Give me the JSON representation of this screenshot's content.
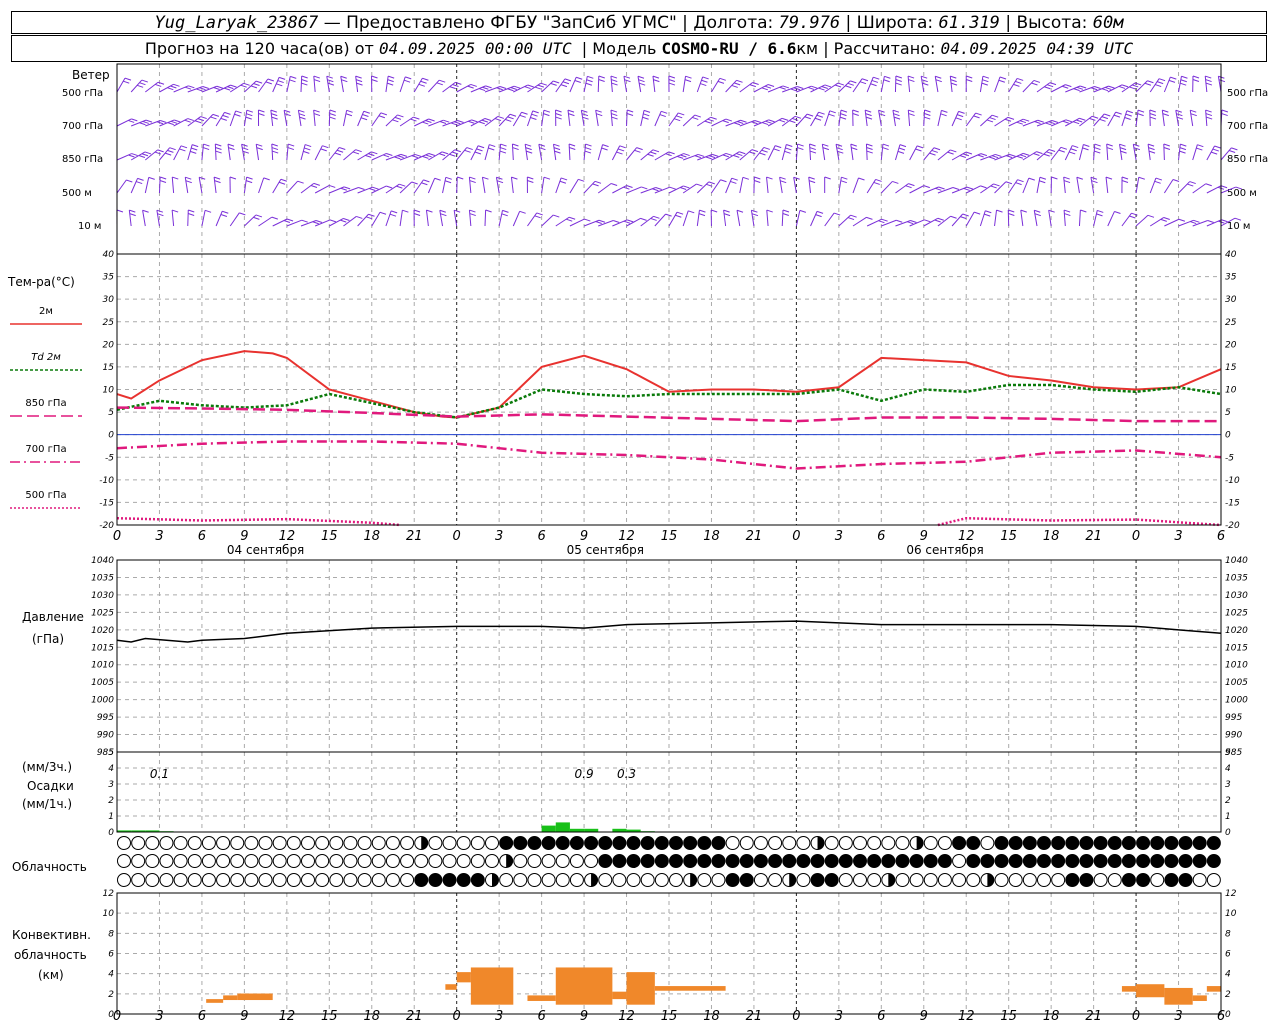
{
  "header": {
    "station": "Yug_Laryak_23867",
    "provider": "— Предоставлено ФГБУ \"ЗапСиб УГМС\" | Долгота:",
    "lon": "79.976",
    "lat_label": "| Широта:",
    "lat": "61.319",
    "alt_label": "| Высота:",
    "alt": "60м",
    "forecast_label": "Прогноз на 120 часа(ов) от",
    "forecast_from": "04.09.2025 00:00 UTC",
    "model_label": "| Модель",
    "model": "COSMO-RU / 6.6",
    "model_unit": "км",
    "calc_label": "| Рассчитано:",
    "calc": "04.09.2025 04:39 UTC"
  },
  "wind_panel": {
    "title": "Ветер",
    "levels": [
      "500 гПа",
      "700 гПа",
      "850 гПа",
      "500 м",
      "10 м"
    ]
  },
  "temp_panel": {
    "title": "Тем-ра(°C)",
    "legend": [
      {
        "label": "2м",
        "color": "#e8322f",
        "dash": ""
      },
      {
        "label": "Td 2м",
        "color": "#0a7a0a",
        "dash": "3,2"
      },
      {
        "label": "850 гПа",
        "color": "#e0197d",
        "dash": "12,5"
      },
      {
        "label": "700 гПа",
        "color": "#e0197d",
        "dash": "10,4,2,4"
      },
      {
        "label": "500 гПа",
        "color": "#e0197d",
        "dash": "2,2"
      }
    ]
  },
  "pressure_panel": {
    "title": "Давление",
    "unit": "(гПа)"
  },
  "precip_panel": {
    "unit3": "(мм/3ч.)",
    "title": "Осадки",
    "unit1": "(мм/1ч.)",
    "labels": [
      {
        "t": 3,
        "text": "0.1"
      },
      {
        "t": 33,
        "text": "0.9"
      },
      {
        "t": 36,
        "text": "0.3"
      }
    ]
  },
  "cloud_panel": {
    "title": "Облачность"
  },
  "conv_panel": {
    "title1": "Конвективн.",
    "title2": "облачность",
    "unit": "(км)"
  },
  "x_hour_labels": [
    "0",
    "3",
    "6",
    "9",
    "12",
    "15",
    "18",
    "21",
    "0",
    "3",
    "6",
    "9",
    "12",
    "15",
    "18",
    "21",
    "0",
    "3",
    "6",
    "9",
    "12",
    "15",
    "18",
    "21",
    "0",
    "3",
    "6"
  ],
  "day_labels": [
    "04 сентября",
    "05 сентября",
    "06 сентября"
  ],
  "colors": {
    "wind": "#7a2fd8",
    "temp2m": "#e8322f",
    "td": "#0a7a0a",
    "upper": "#e0197d",
    "pressure": "#000000",
    "precip": "#18c018",
    "conv": "#f0882a",
    "zero": "#2040d0"
  },
  "chart_data": [
    {
      "type": "line",
      "title": "Тем-ра(°C)",
      "x_unit": "hours from 04.09.2025 00:00 UTC",
      "ylim": [
        -20,
        40
      ],
      "series": [
        {
          "name": "2м",
          "x": [
            0,
            1,
            3,
            6,
            9,
            11,
            12,
            15,
            18,
            21,
            23,
            24,
            27,
            30,
            33,
            36,
            39,
            42,
            45,
            48,
            51,
            54,
            57,
            60,
            63,
            66,
            69,
            72,
            75,
            78
          ],
          "values": [
            9,
            8,
            12,
            16.5,
            18.5,
            18,
            17,
            10,
            7.5,
            5,
            4,
            3.8,
            6,
            15,
            17.5,
            14.5,
            9.5,
            10,
            10,
            9.5,
            10.5,
            17,
            16.5,
            16,
            13,
            12,
            10.5,
            10,
            10.5,
            14.5
          ]
        },
        {
          "name": "Td 2м",
          "x": [
            0,
            3,
            6,
            9,
            12,
            15,
            18,
            21,
            24,
            27,
            30,
            33,
            36,
            39,
            42,
            45,
            48,
            51,
            54,
            57,
            60,
            63,
            66,
            69,
            72,
            75,
            78
          ],
          "values": [
            5.5,
            7.5,
            6.5,
            6,
            6.5,
            9,
            7,
            5,
            3.8,
            6,
            10,
            9,
            8.5,
            9,
            9,
            9,
            9,
            10,
            7.5,
            10,
            9.5,
            11,
            11,
            10,
            9.5,
            10.5,
            9
          ]
        },
        {
          "name": "850 гПа",
          "x": [
            0,
            6,
            12,
            18,
            24,
            30,
            36,
            42,
            48,
            54,
            60,
            66,
            72,
            78
          ],
          "values": [
            6,
            5.8,
            5.5,
            4.8,
            4,
            4.5,
            4,
            3.5,
            3,
            3.8,
            3.8,
            3.5,
            3,
            3
          ]
        },
        {
          "name": "700 гПа",
          "x": [
            0,
            6,
            12,
            18,
            24,
            30,
            36,
            42,
            48,
            54,
            60,
            66,
            72,
            78
          ],
          "values": [
            -3,
            -2,
            -1.5,
            -1.5,
            -2,
            -4,
            -4.5,
            -5.5,
            -7.5,
            -6.5,
            -6,
            -4,
            -3.5,
            -5
          ]
        },
        {
          "name": "500 гПа",
          "x": [
            0,
            6,
            12,
            18,
            20
          ],
          "values": [
            -18.5,
            -19,
            -18.7,
            -19.5,
            -20
          ]
        },
        {
          "name": "500 гПа",
          "x": [
            58,
            60,
            66,
            72,
            78
          ],
          "values": [
            -20,
            -18.5,
            -19,
            -18.8,
            -20
          ]
        }
      ]
    },
    {
      "type": "line",
      "title": "Давление",
      "ylim": [
        985,
        1040
      ],
      "series": [
        {
          "name": "Давление",
          "x": [
            0,
            1,
            2,
            5,
            6,
            9,
            12,
            18,
            24,
            30,
            33,
            36,
            42,
            48,
            54,
            60,
            66,
            72,
            75,
            78
          ],
          "values": [
            1017,
            1016.5,
            1017.5,
            1016.5,
            1017,
            1017.5,
            1019,
            1020.5,
            1021,
            1021,
            1020.5,
            1021.5,
            1022,
            1022.5,
            1021.5,
            1021.5,
            1021.5,
            1021,
            1020,
            1019
          ]
        }
      ]
    },
    {
      "type": "bar",
      "title": "Осадки",
      "ylim": [
        0,
        5
      ],
      "series": [
        {
          "name": "Осадки",
          "x": [
            0,
            1,
            2,
            3,
            30,
            31,
            32,
            33,
            35,
            36,
            37
          ],
          "values": [
            0.1,
            0.1,
            0.1,
            0.05,
            0.4,
            0.6,
            0.2,
            0.2,
            0.2,
            0.15,
            0.05
          ]
        }
      ]
    },
    {
      "type": "bar",
      "title": "Конвективн. облачность",
      "ylim": [
        0,
        13
      ],
      "segments": [
        {
          "x0": 6.3,
          "x1": 7.5,
          "y0": 1.2,
          "y1": 1.6
        },
        {
          "x0": 7.5,
          "x1": 8.5,
          "y0": 1.5,
          "y1": 2.0
        },
        {
          "x0": 8.5,
          "x1": 11,
          "y0": 1.5,
          "y1": 2.2
        },
        {
          "x0": 23.2,
          "x1": 24,
          "y0": 2.6,
          "y1": 3.2
        },
        {
          "x0": 24,
          "x1": 25,
          "y0": 3.4,
          "y1": 4.5
        },
        {
          "x0": 25,
          "x1": 28,
          "y0": 1.0,
          "y1": 5.0
        },
        {
          "x0": 29,
          "x1": 31,
          "y0": 1.4,
          "y1": 2.0
        },
        {
          "x0": 31,
          "x1": 35,
          "y0": 1.0,
          "y1": 5.0
        },
        {
          "x0": 35,
          "x1": 36,
          "y0": 1.6,
          "y1": 2.4
        },
        {
          "x0": 36,
          "x1": 38,
          "y0": 1.0,
          "y1": 4.5
        },
        {
          "x0": 38,
          "x1": 43,
          "y0": 2.5,
          "y1": 3.0
        },
        {
          "x0": 71,
          "x1": 72,
          "y0": 2.4,
          "y1": 3.0
        },
        {
          "x0": 72,
          "x1": 74,
          "y0": 1.8,
          "y1": 3.2
        },
        {
          "x0": 74,
          "x1": 76,
          "y0": 1.0,
          "y1": 2.8
        },
        {
          "x0": 76,
          "x1": 77,
          "y0": 1.4,
          "y1": 2.0
        },
        {
          "x0": 77,
          "x1": 78,
          "y0": 2.4,
          "y1": 3.0
        }
      ]
    }
  ]
}
